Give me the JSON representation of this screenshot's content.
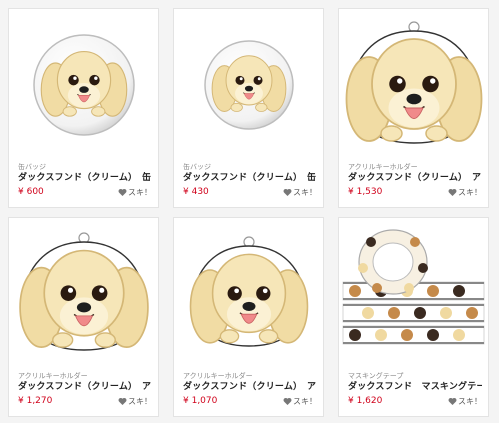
{
  "products": [
    {
      "category": "缶バッジ",
      "name": "ダックスフンド（クリーム）　缶",
      "price": "¥ 600",
      "like_label": "スキ！",
      "item_type": "badge-large"
    },
    {
      "category": "缶バッジ",
      "name": "ダックスフンド（クリーム）　缶",
      "price": "¥ 430",
      "like_label": "スキ！",
      "item_type": "badge-small"
    },
    {
      "category": "アクリルキーホルダー",
      "name": "ダックスフンド（クリーム）　ア",
      "price": "¥ 1,530",
      "like_label": "スキ！",
      "item_type": "keyholder-large"
    },
    {
      "category": "アクリルキーホルダー",
      "name": "ダックスフンド（クリーム）　ア",
      "price": "¥ 1,270",
      "like_label": "スキ！",
      "item_type": "keyholder-medium"
    },
    {
      "category": "アクリルキーホルダー",
      "name": "ダックスフンド（クリーム）　ア",
      "price": "¥ 1,070",
      "like_label": "スキ！",
      "item_type": "keyholder-small"
    },
    {
      "category": "マスキングテープ",
      "name": "ダックスフンド　マスキングテー",
      "price": "¥ 1,620",
      "like_label": "スキ！",
      "item_type": "masking-tape"
    }
  ],
  "colors": {
    "price": "#d0021b",
    "fur": "#f3e1ad",
    "fur_dark": "#d9bf7e",
    "tongue": "#f08a8a",
    "heart": "#777777"
  },
  "icons": {
    "like": "heart-icon",
    "product_art": "dachshund-face-illustration"
  }
}
